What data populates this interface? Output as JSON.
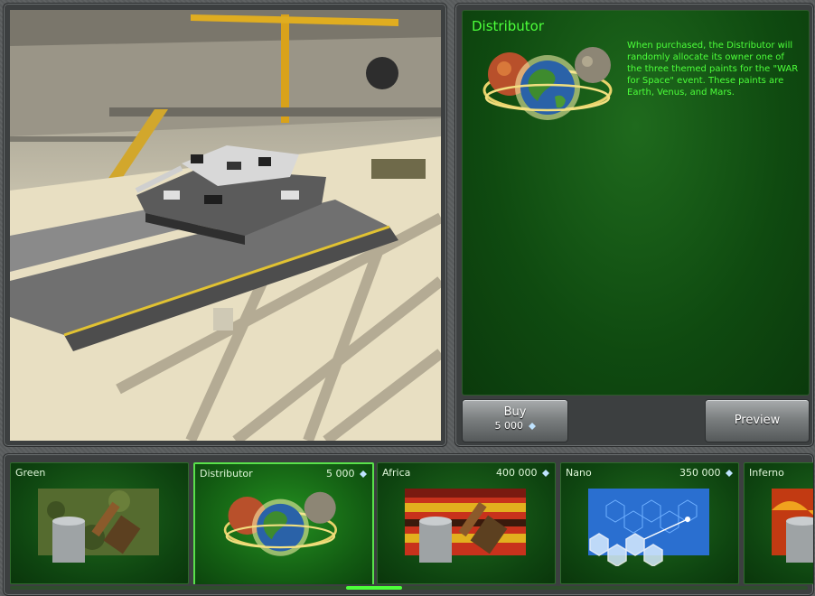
{
  "item": {
    "title": "Distributor",
    "description": "When purchased, the Distributor will randomly allocate its owner one of the three themed paints for the \"WAR for Space\" event. These paints are Earth, Venus, and Mars.",
    "icon": "planets-icon"
  },
  "buttons": {
    "buy_label": "Buy",
    "buy_price": "5 000",
    "preview_label": "Preview"
  },
  "colors": {
    "accent_text": "#4cff3a",
    "panel_green": "#0f4a10",
    "selected_border": "#59e14b"
  },
  "paints": [
    {
      "name": "Green",
      "price": "",
      "icon": "paint-can-brush-icon",
      "selected": false
    },
    {
      "name": "Distributor",
      "price": "5 000",
      "icon": "planets-icon",
      "selected": true
    },
    {
      "name": "Africa",
      "price": "400 000",
      "icon": "paint-can-brush-icon",
      "selected": false
    },
    {
      "name": "Nano",
      "price": "350 000",
      "icon": "hexagon-pattern-icon",
      "selected": false
    },
    {
      "name": "Inferno",
      "price": "",
      "icon": "paint-can-brush-icon",
      "selected": false
    }
  ]
}
